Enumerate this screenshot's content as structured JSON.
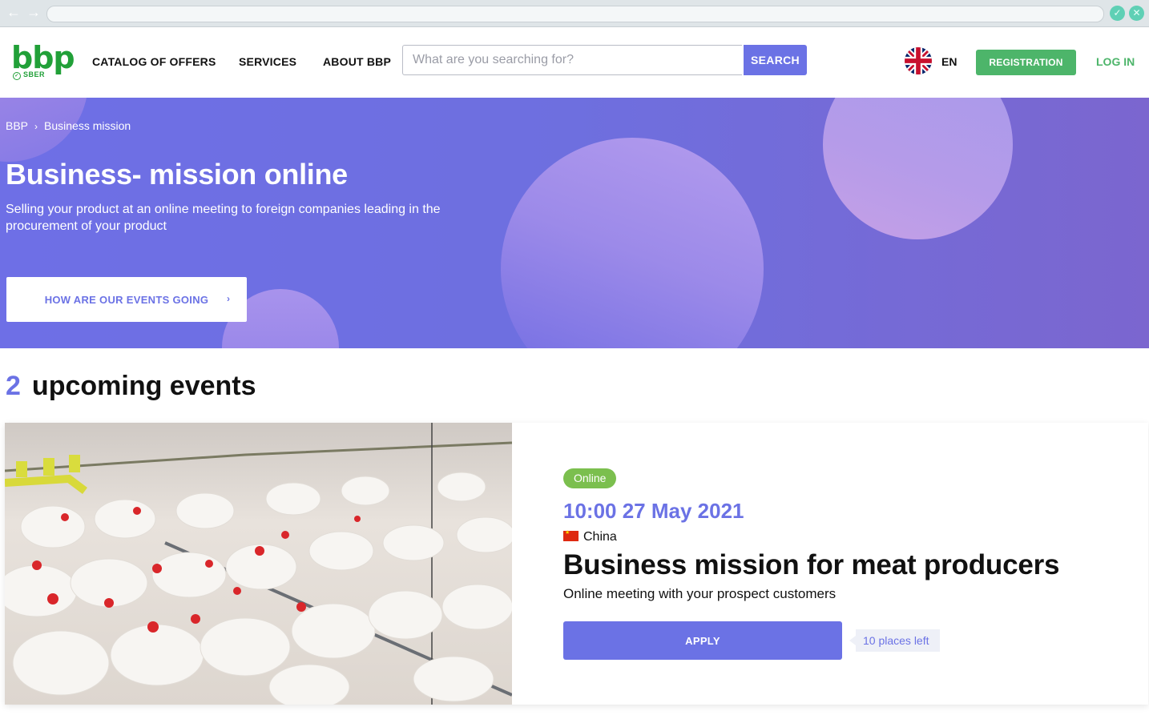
{
  "browser": {
    "back_icon": "arrow-left-icon",
    "forward_icon": "arrow-right-icon"
  },
  "header": {
    "logo_text": "bbp",
    "logo_sub": "SBER",
    "nav": [
      "CATALOG OF OFFERS",
      "SERVICES",
      "ABOUT BBP"
    ],
    "search_placeholder": "What are you searching for?",
    "search_label": "SEARCH",
    "language": "EN",
    "registration_label": "REGISTRATION",
    "login_label": "LOG IN"
  },
  "hero": {
    "breadcrumb": [
      "BBP",
      "Business mission"
    ],
    "title": "Business- mission online",
    "subtitle": "Selling your product at an online meeting to foreign companies leading in the procurement of your product",
    "button_label": "HOW ARE OUR EVENTS GOING"
  },
  "events": {
    "count": "2",
    "heading": "upcoming events",
    "items": [
      {
        "badge": "Online",
        "datetime": "10:00 27 May 2021",
        "country": "China",
        "title": "Business mission for meat producers",
        "subtitle": "Online meeting with your prospect customers",
        "apply_label": "APPLY",
        "places_left": "10 places left"
      }
    ]
  },
  "colors": {
    "accent": "#6b72e5",
    "green": "#4db56a",
    "badge_green": "#7bbf4e"
  }
}
